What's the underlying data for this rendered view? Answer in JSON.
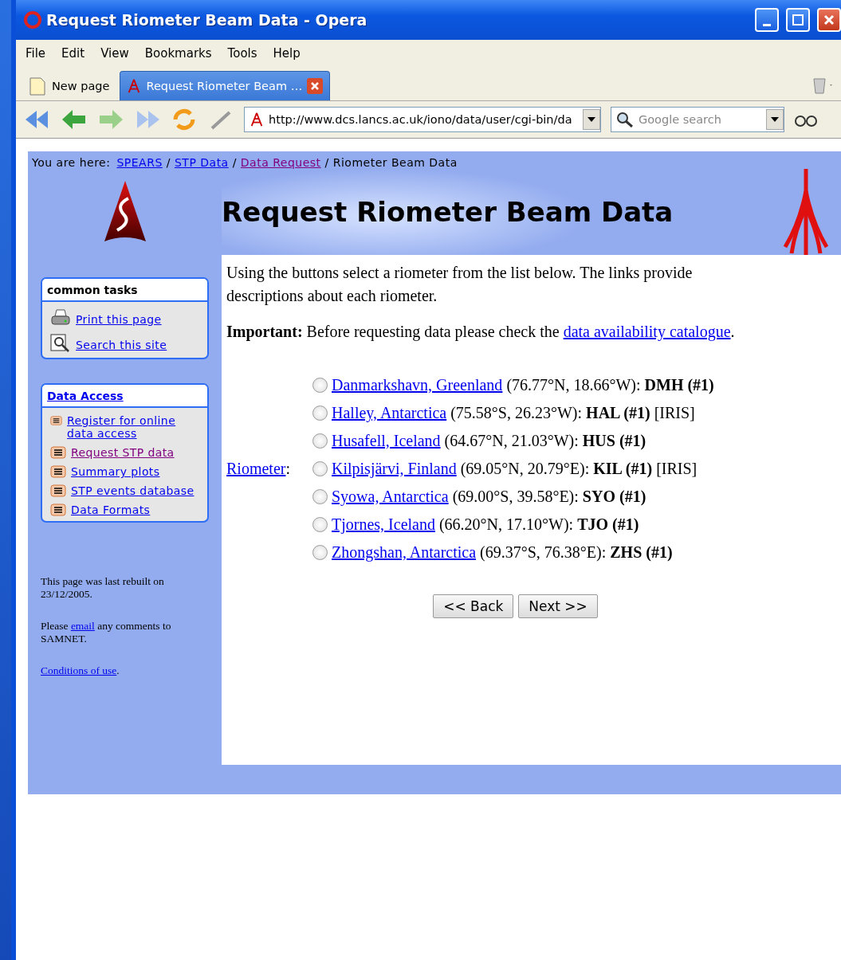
{
  "window": {
    "title": "Request Riometer Beam Data - Opera"
  },
  "menu": [
    "File",
    "Edit",
    "View",
    "Bookmarks",
    "Tools",
    "Help"
  ],
  "tabs": [
    {
      "label": "New page",
      "selected": false,
      "kind": "blank"
    },
    {
      "label": "Request Riometer Beam …",
      "selected": true,
      "kind": "site"
    }
  ],
  "address": {
    "value": "http://www.dcs.lancs.ac.uk/iono/data/user/cgi-bin/da"
  },
  "search": {
    "placeholder": "Google search"
  },
  "page": {
    "breadcrumb": {
      "label": "You are here:",
      "separator": "/",
      "links": [
        {
          "text": "SPEARS",
          "visited": false
        },
        {
          "text": "STP Data",
          "visited": false
        },
        {
          "text": "Data Request",
          "visited": true
        }
      ],
      "current": "Riometer Beam Data"
    },
    "heading": "Request Riometer Beam Data",
    "sidebar": {
      "common_tasks": {
        "title": "common tasks",
        "items": [
          {
            "label": "Print this page",
            "kind": "print"
          },
          {
            "label": "Search this site",
            "kind": "search"
          }
        ]
      },
      "data_access": {
        "title": "Data Access",
        "items": [
          {
            "label": "Register for online data access",
            "visited": false
          },
          {
            "label": "Request STP data",
            "visited": true
          },
          {
            "label": "Summary plots",
            "visited": false
          },
          {
            "label": "STP events database",
            "visited": false
          },
          {
            "label": "Data Formats",
            "visited": false
          }
        ]
      },
      "rebuilt": "This page was last rebuilt on 23/12/2005.",
      "contact": {
        "before": "Please",
        "link": "email",
        "after": "any comments to SAMNET."
      },
      "conditions": {
        "link": "Conditions of use",
        "after": "."
      }
    },
    "intro": "Using the buttons select a riometer from the list below. The links provide descriptions about each riometer.",
    "important": {
      "label": "Important:",
      "text": "Before requesting data please check the",
      "link": "data availability catalogue",
      "after": "."
    },
    "field_label": "Riometer",
    "field_label_after": ":",
    "riometers": [
      {
        "site": "Danmarkshavn, Greenland",
        "coords": "(76.77°N, 18.66°W):",
        "code": "DMH (#1)",
        "selected": false
      },
      {
        "site": "Halley, Antarctica",
        "coords": "(75.58°S, 26.23°W):",
        "code": "HAL (#1)",
        "note": "[IRIS]",
        "selected": false
      },
      {
        "site": "Husafell, Iceland",
        "coords": "(64.67°N, 21.03°W):",
        "code": "HUS (#1)",
        "selected": false
      },
      {
        "site": "Kilpisjärvi, Finland",
        "coords": "(69.05°N, 20.79°E):",
        "code": "KIL (#1)",
        "note": "[IRIS]",
        "selected": false
      },
      {
        "site": "Syowa, Antarctica",
        "coords": "(69.00°S, 39.58°E):",
        "code": "SYO (#1)",
        "selected": false
      },
      {
        "site": "Tjornes, Iceland",
        "coords": "(66.20°N, 17.10°W):",
        "code": "TJO (#1)",
        "selected": false
      },
      {
        "site": "Zhongshan, Antarctica",
        "coords": "(69.37°S, 76.38°E):",
        "code": "ZHS (#1)",
        "selected": false
      }
    ],
    "buttons": [
      "<< Back",
      "Next >>"
    ]
  }
}
